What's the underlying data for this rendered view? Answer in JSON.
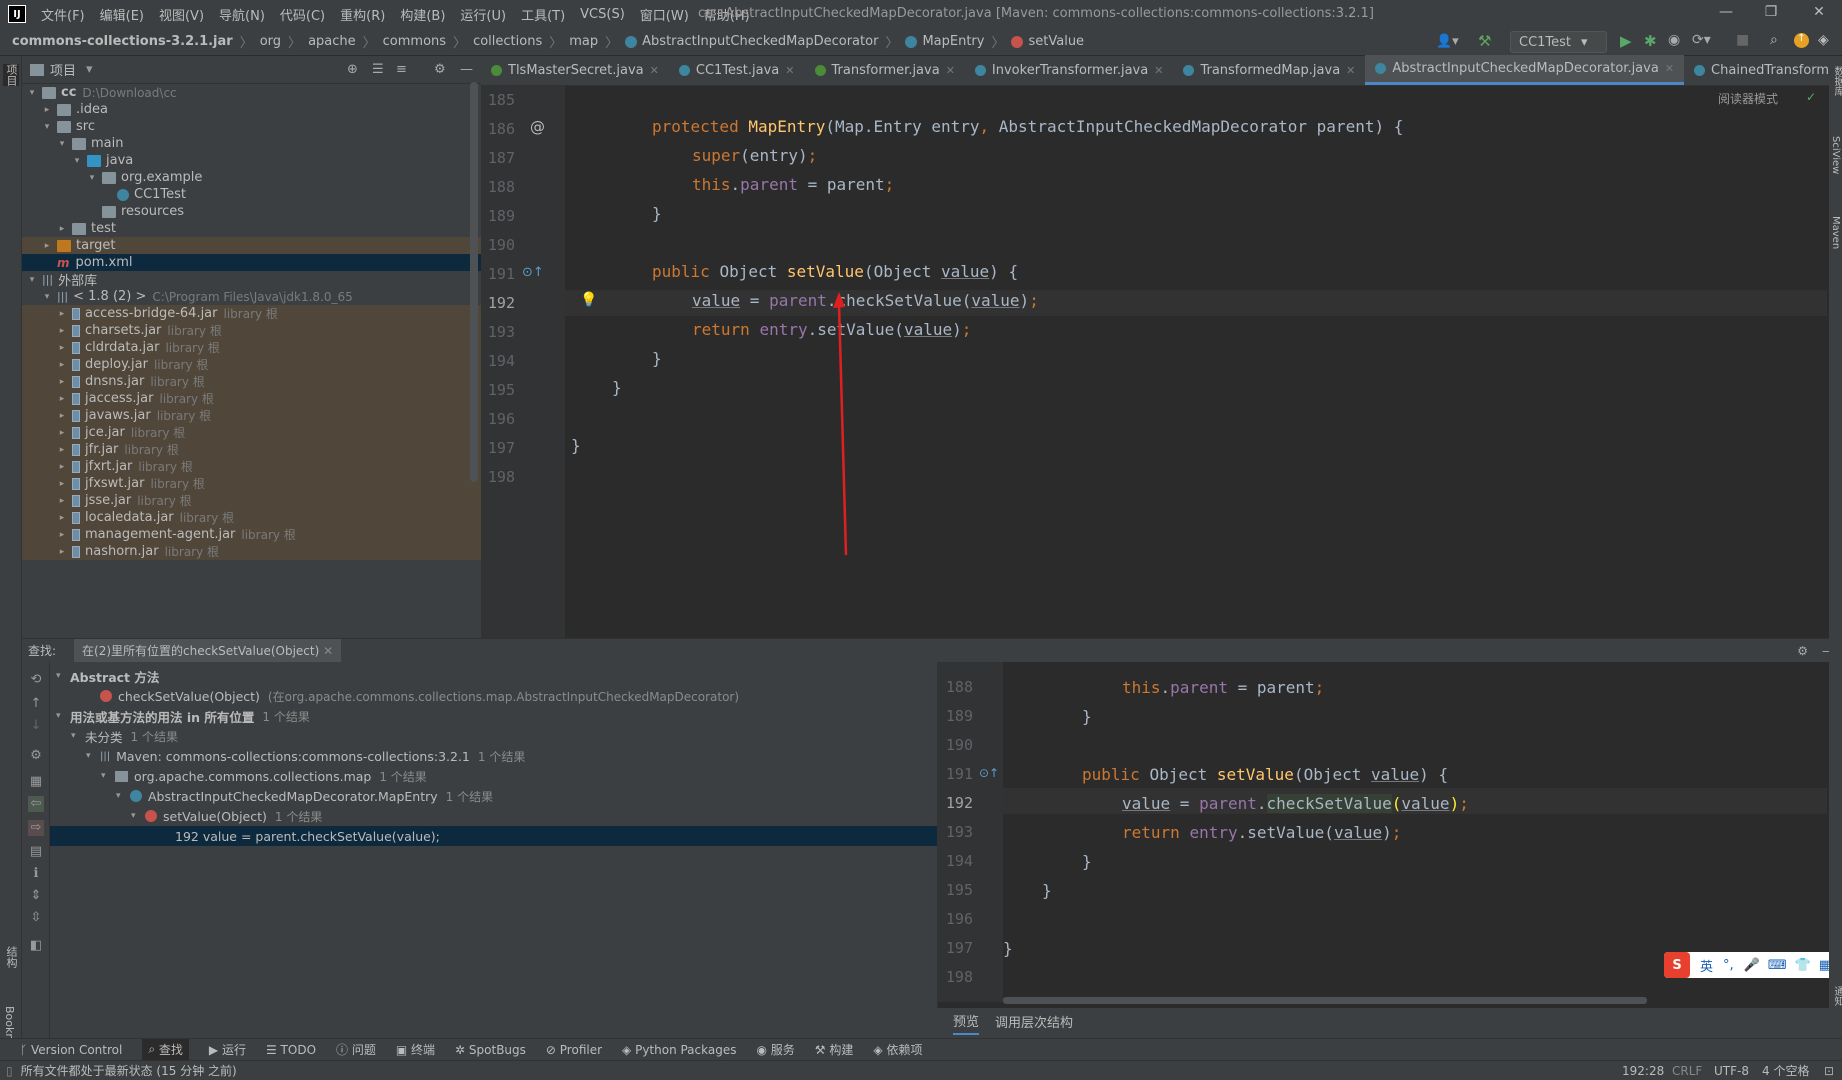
{
  "menubar": {
    "items": [
      "文件(F)",
      "编辑(E)",
      "视图(V)",
      "导航(N)",
      "代码(C)",
      "重构(R)",
      "构建(B)",
      "运行(U)",
      "工具(T)",
      "VCS(S)",
      "窗口(W)",
      "帮助(H)"
    ],
    "window_title": "cc - AbstractInputCheckedMapDecorator.java [Maven: commons-collections:commons-collections:3.2.1]"
  },
  "breadcrumb": [
    "commons-collections-3.2.1.jar",
    "org",
    "apache",
    "commons",
    "collections",
    "map",
    "AbstractInputCheckedMapDecorator",
    "MapEntry",
    "setValue"
  ],
  "run_config": "CC1Test",
  "project": {
    "header": "项目",
    "rows": [
      {
        "label": "cc",
        "extra": "D:\\Download\\cc"
      },
      {
        "label": ".idea",
        "extra": ""
      },
      {
        "label": "src",
        "extra": ""
      },
      {
        "label": "main",
        "extra": ""
      },
      {
        "label": "java",
        "extra": ""
      },
      {
        "label": "org.example",
        "extra": ""
      },
      {
        "label": "CC1Test",
        "extra": ""
      },
      {
        "label": "resources",
        "extra": ""
      },
      {
        "label": "test",
        "extra": ""
      },
      {
        "label": "target",
        "extra": ""
      },
      {
        "label": "pom.xml",
        "extra": ""
      },
      {
        "label": "外部库",
        "extra": ""
      },
      {
        "label": "< 1.8 (2) >",
        "extra": "C:\\Program Files\\Java\\jdk1.8.0_65"
      },
      {
        "label": "access-bridge-64.jar",
        "extra": "library 根"
      },
      {
        "label": "charsets.jar",
        "extra": "library 根"
      },
      {
        "label": "cldrdata.jar",
        "extra": "library 根"
      },
      {
        "label": "deploy.jar",
        "extra": "library 根"
      },
      {
        "label": "dnsns.jar",
        "extra": "library 根"
      },
      {
        "label": "jaccess.jar",
        "extra": "library 根"
      },
      {
        "label": "javaws.jar",
        "extra": "library 根"
      },
      {
        "label": "jce.jar",
        "extra": "library 根"
      },
      {
        "label": "jfr.jar",
        "extra": "library 根"
      },
      {
        "label": "jfxrt.jar",
        "extra": "library 根"
      },
      {
        "label": "jfxswt.jar",
        "extra": "library 根"
      },
      {
        "label": "jsse.jar",
        "extra": "library 根"
      },
      {
        "label": "localedata.jar",
        "extra": "library 根"
      },
      {
        "label": "management-agent.jar",
        "extra": "library 根"
      },
      {
        "label": "nashorn.jar",
        "extra": "library 根"
      }
    ]
  },
  "tabs": [
    "TlsMasterSecret.java",
    "CC1Test.java",
    "Transformer.java",
    "InvokerTransformer.java",
    "TransformedMap.java",
    "AbstractInputCheckedMapDecorator.java",
    "ChainedTransformer.java"
  ],
  "active_tab": "AbstractInputCheckedMapDecorator.java",
  "reader_mode": "阅读器模式",
  "editor": {
    "line_numbers": [
      "185",
      "186",
      "187",
      "188",
      "189",
      "190",
      "191",
      "192",
      "193",
      "194",
      "195",
      "196",
      "197",
      "198"
    ],
    "current_line": "192"
  },
  "find": {
    "label": "查找:",
    "tab": "在(2)里所有位置的checkSetValue(Object)",
    "rows": [
      {
        "text": "Abstract 方法",
        "extra": ""
      },
      {
        "text": "checkSetValue(Object)",
        "extra": "(在org.apache.commons.collections.map.AbstractInputCheckedMapDecorator)"
      },
      {
        "text": "用法或基方法的用法 in 所有位置",
        "extra": "1 个结果"
      },
      {
        "text": "未分类",
        "extra": "1 个结果"
      },
      {
        "text": "Maven: commons-collections:commons-collections:3.2.1",
        "extra": "1 个结果"
      },
      {
        "text": "org.apache.commons.collections.map",
        "extra": "1 个结果"
      },
      {
        "text": "AbstractInputCheckedMapDecorator.MapEntry",
        "extra": "1 个结果"
      },
      {
        "text": "setValue(Object)",
        "extra": "1 个结果"
      },
      {
        "text": "192 value = parent.checkSetValue(value);",
        "extra": ""
      }
    ]
  },
  "preview": {
    "line_numbers": [
      "188",
      "189",
      "190",
      "191",
      "192",
      "193",
      "194",
      "195",
      "196",
      "197",
      "198"
    ],
    "tabs": [
      "预览",
      "调用层次结构"
    ]
  },
  "toolwindows": [
    "Version Control",
    "查找",
    "运行",
    "TODO",
    "问题",
    "终端",
    "SpotBugs",
    "Profiler",
    "Python Packages",
    "服务",
    "构建",
    "依赖项"
  ],
  "status": {
    "message": "所有文件都处于最新状态 (15 分钟 之前)",
    "position": "192:28",
    "line_sep": "CRLF",
    "encoding": "UTF-8",
    "indent": "4 个空格"
  },
  "side_labels": {
    "left_top": "项目",
    "left_mid": "结构",
    "left_bottom": "Bookmarks",
    "right1": "数据库",
    "right2": "SciView",
    "right3": "Maven",
    "right4": "通知"
  },
  "ime": {
    "lang": "英"
  }
}
